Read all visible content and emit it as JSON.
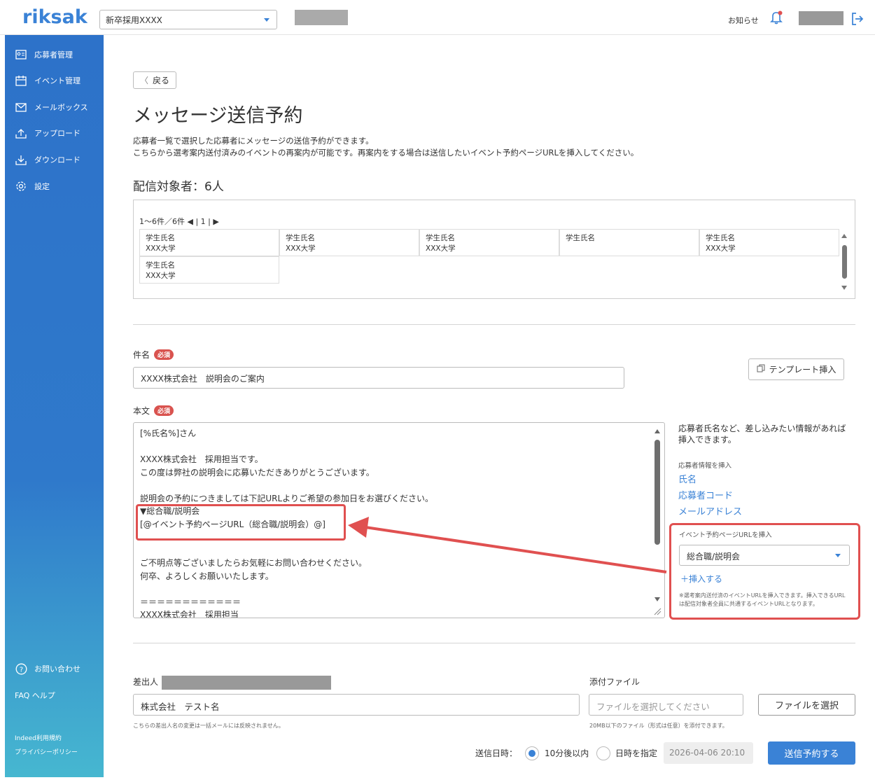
{
  "header": {
    "logo": "riksak",
    "project_select": "新卒採用XXXX",
    "notice": "お知らせ"
  },
  "sidebar": {
    "items": [
      {
        "label": "応募者管理",
        "icon": "applicant-card-icon"
      },
      {
        "label": "イベント管理",
        "icon": "calendar-icon"
      },
      {
        "label": "メールボックス",
        "icon": "mail-icon"
      },
      {
        "label": "アップロード",
        "icon": "upload-icon"
      },
      {
        "label": "ダウンロード",
        "icon": "download-icon"
      },
      {
        "label": "設定",
        "icon": "gear-icon"
      }
    ],
    "contact": "お問い合わせ",
    "help": "FAQ ヘルプ",
    "terms": "Indeed利用規約",
    "privacy": "プライバシーポリシー"
  },
  "page": {
    "back": "戻る",
    "title": "メッセージ送信予約",
    "desc1": "応募者一覧で選択した応募者にメッセージの送信予約ができます。",
    "desc2": "こちらから選考案内送付済みのイベントの再案内が可能です。再案内をする場合は送信したいイベント予約ページURLを挿入してください。",
    "target_count": "配信対象者：6人"
  },
  "recipients": {
    "pager": "1～6件／6件 ◀ | 1 | ▶",
    "cells": [
      {
        "name": "学生氏名",
        "school": "XXX大学"
      },
      {
        "name": "学生氏名",
        "school": "XXX大学"
      },
      {
        "name": "学生氏名",
        "school": "XXX大学"
      },
      {
        "name": "学生氏名",
        "school": ""
      },
      {
        "name": "学生氏名",
        "school": "XXX大学"
      },
      {
        "name": "学生氏名",
        "school": "XXX大学"
      }
    ]
  },
  "form": {
    "subject_label": "件名",
    "required": "必須",
    "subject_value": "XXXX株式会社　説明会のご案内",
    "template_button": "テンプレート挿入",
    "body_label": "本文",
    "body_lines": [
      "[%氏名%]さん",
      "",
      "XXXX株式会社　採用担当です。",
      "この度は弊社の説明会に応募いただきありがとうございます。",
      "",
      "説明会の予約につきましては下記URLよりご希望の参加日をお選びください。",
      "▼総合職/説明会",
      "[@イベント予約ページURL（総合職/説明会）@]",
      "",
      "",
      "ご不明点等ございましたらお気軽にお問い合わせください。",
      "何卒、よろしくお願いいたします。",
      "",
      "＝＝＝＝＝＝＝＝＝＝＝＝",
      "XXXX株式会社　採用担当"
    ]
  },
  "insert_panel": {
    "intro": "応募者氏名など、差し込みたい情報があれば挿入できます。",
    "applicant_label": "応募者情報を挿入",
    "links": [
      "氏名",
      "応募者コード",
      "メールアドレス"
    ],
    "event_label": "イベント予約ページURLを挿入",
    "event_select": "総合職/説明会",
    "insert": "＋挿入する",
    "note": "※選考案内送付済のイベントURLを挿入できます。挿入できるURLは配信対象者全員に共通するイベントURLとなります。"
  },
  "sender": {
    "label": "差出人",
    "value": "株式会社　テスト名",
    "note": "こちらの差出人名の変更は一括メールには反映されません。"
  },
  "attachment": {
    "label": "添付ファイル",
    "placeholder": "ファイルを選択してください",
    "button": "ファイルを選択",
    "note": "20MB以下のファイル（形式は任意）を添付できます。"
  },
  "schedule": {
    "label": "送信日時：",
    "option1": "10分後以内",
    "option2": "日時を指定",
    "datetime": "2026-04-06 20:10",
    "submit": "送信予約する"
  },
  "colors": {
    "accent": "#3a82d6",
    "highlight": "#e05050"
  }
}
